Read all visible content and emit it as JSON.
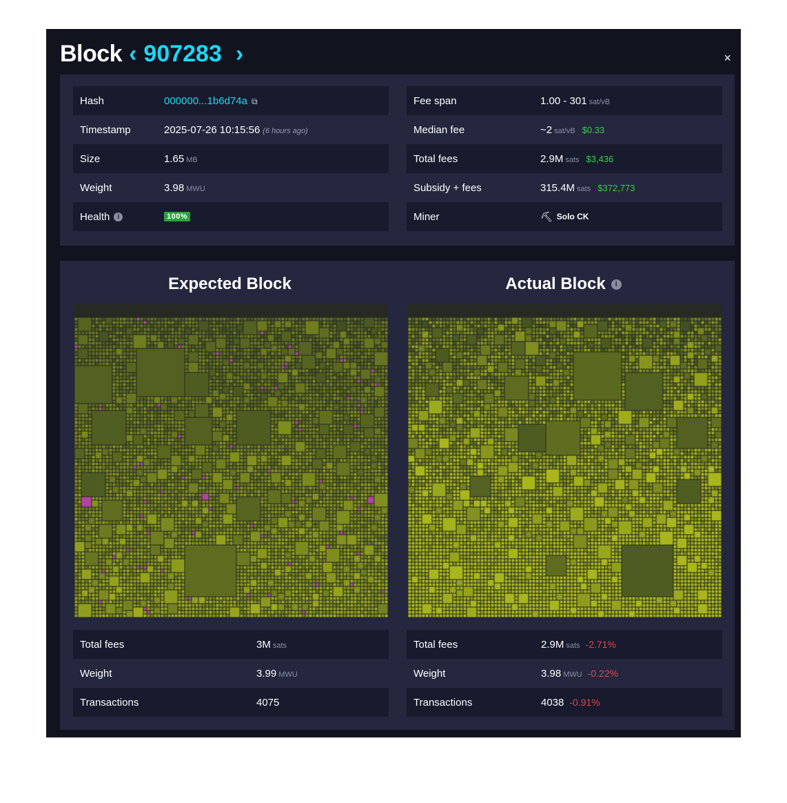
{
  "header": {
    "title": "Block",
    "prev_label": "‹",
    "block_height": "907283",
    "next_label": "›",
    "close_label": "×"
  },
  "details_left": {
    "hash": {
      "label": "Hash",
      "value": "000000...1b6d74a",
      "copy_icon": "copy-icon"
    },
    "timestamp": {
      "label": "Timestamp",
      "value": "2025-07-26 10:15:56",
      "ago": "(6 hours ago)"
    },
    "size": {
      "label": "Size",
      "value": "1.65",
      "unit": "MB"
    },
    "weight": {
      "label": "Weight",
      "value": "3.98",
      "unit": "MWU"
    },
    "health": {
      "label": "Health",
      "value": "100%",
      "info_icon": "info-icon"
    }
  },
  "details_right": {
    "fee_span": {
      "label": "Fee span",
      "value": "1.00 - 301",
      "unit": "sat/vB"
    },
    "median_fee": {
      "label": "Median fee",
      "value": "~2",
      "unit": "sat/vB",
      "usd": "$0.33"
    },
    "total_fees": {
      "label": "Total fees",
      "value": "2.9M",
      "unit": "sats",
      "usd": "$3,436"
    },
    "subsidy": {
      "label": "Subsidy + fees",
      "value": "315.4M",
      "unit": "sats",
      "usd": "$372,773"
    },
    "miner": {
      "label": "Miner",
      "value": "Solo CK",
      "icon": "pickaxe-icon"
    }
  },
  "expected": {
    "title": "Expected Block",
    "total_fees": {
      "label": "Total fees",
      "value": "3M",
      "unit": "sats"
    },
    "weight": {
      "label": "Weight",
      "value": "3.99",
      "unit": "MWU"
    },
    "transactions": {
      "label": "Transactions",
      "value": "4075"
    }
  },
  "actual": {
    "title": "Actual Block",
    "total_fees": {
      "label": "Total fees",
      "value": "2.9M",
      "unit": "sats",
      "delta": "-2.71%"
    },
    "weight": {
      "label": "Weight",
      "value": "3.98",
      "unit": "MWU",
      "delta": "-0.22%"
    },
    "transactions": {
      "label": "Transactions",
      "value": "4038",
      "delta": "-0.91%"
    }
  },
  "colors": {
    "accent": "#1bd8f4",
    "usd": "#3bcc49",
    "negative": "#e0464f",
    "tx_low": "#3d4a22",
    "tx_high": "#a8b61c",
    "tx_missing": "#b0449f"
  }
}
